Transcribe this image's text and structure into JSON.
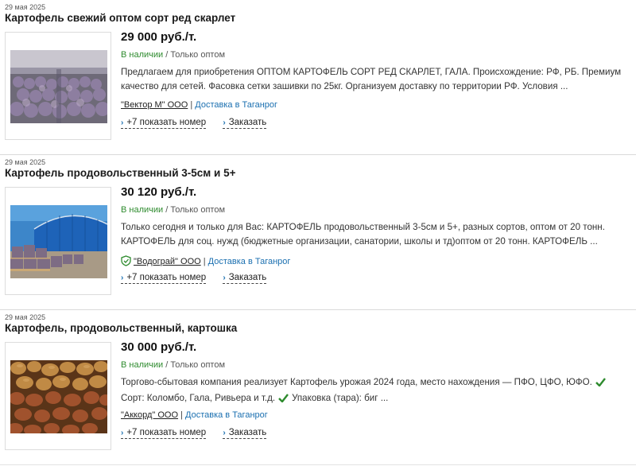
{
  "listings": [
    {
      "date": "29 мая 2025",
      "title": "Картофель свежий оптом сорт ред скарлет",
      "price": "29 000 руб./т.",
      "availability": "В наличии",
      "stock_sep": " / ",
      "wholesale": "Только оптом",
      "description_lines": [
        "Предлагаем для приобретения ОПТОМ КАРТОФЕЛЬ СОРТ РЕД СКАРЛЕТ, ГАЛА. Происхождение: РФ, РБ. Премиум",
        "качество для сетей. Фасовка сетки зашивки по 25кг. Организуем доставку по территории РФ. Условия ..."
      ],
      "seller": "\"Вектор М\" ООО",
      "seller_sep": " | ",
      "delivery": "Доставка в Таганрог",
      "show_phone": "+7 показать номер",
      "order": "Заказать",
      "verified": false
    },
    {
      "date": "29 мая 2025",
      "title": "Картофель продовольственный 3-5см и 5+",
      "price": "30 120 руб./т.",
      "availability": "В наличии",
      "stock_sep": " / ",
      "wholesale": "Только оптом",
      "description_lines": [
        "Только сегодня и только для Вас: КАРТОФЕЛЬ продовольственный 3-5см и 5+, разных сортов, оптом от 20 тонн.",
        "КАРТОФЕЛЬ для соц. нужд (бюджетные организации, санатории, школы и тд)оптом от 20 тонн. КАРТОФЕЛЬ ..."
      ],
      "seller": "\"Водограй\" ООО",
      "seller_sep": " | ",
      "delivery": "Доставка в Таганрог",
      "show_phone": "+7 показать номер",
      "order": "Заказать",
      "verified": true
    },
    {
      "date": "29 мая 2025",
      "title": "Картофель, продовольственный, картошка",
      "price": "30 000 руб./т.",
      "availability": "В наличии",
      "stock_sep": " / ",
      "wholesale": "Только оптом",
      "description_lines": [
        "Торгово-сбытовая компания реализует Картофель урожая 2024 года, место нахождения — ПФО, ЦФО, ЮФО.",
        "Сорт: Коломбо, Гала, Ривьера и т.д.",
        "Упаковка (тара): биг ..."
      ],
      "seller": "\"Аккорд\" ООО",
      "seller_sep": " | ",
      "delivery": "Доставка в Таганрог",
      "show_phone": "+7 показать номер",
      "order": "Заказать",
      "verified": false
    }
  ],
  "colors": {
    "availability": "#2e8b2e",
    "delivery_link": "#1a6fb0",
    "check": "#2e8b2e"
  }
}
